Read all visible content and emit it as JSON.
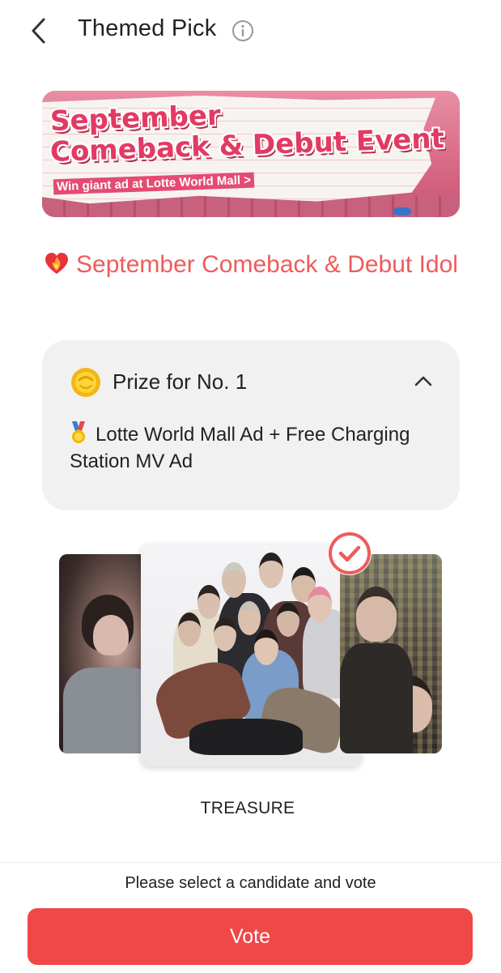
{
  "header": {
    "title": "Themed Pick",
    "back_icon": "chevron-left-icon",
    "info_icon": "info-circle-icon"
  },
  "banner": {
    "line1": "September",
    "line2": "Comeback & Debut Event",
    "subtitle": "Win giant ad at Lotte World Mall >"
  },
  "section": {
    "icon": "burning-heart-icon",
    "title": "September Comeback & Debut Idol"
  },
  "prize": {
    "icon": "coin-icon",
    "title": "Prize for No. 1",
    "medal_icon": "gold-medal-icon",
    "description": "Lotte World Mall Ad + Free Charging Station MV Ad",
    "collapse_icon": "chevron-up-icon"
  },
  "carousel": {
    "selected_candidate": "TREASURE",
    "selected_icon": "check-circle-icon"
  },
  "footer": {
    "hint": "Please select a candidate and vote",
    "vote_label": "Vote"
  },
  "colors": {
    "accent": "#f04747",
    "title_red": "#ef5b5b",
    "card_bg": "#f1f1f1"
  }
}
